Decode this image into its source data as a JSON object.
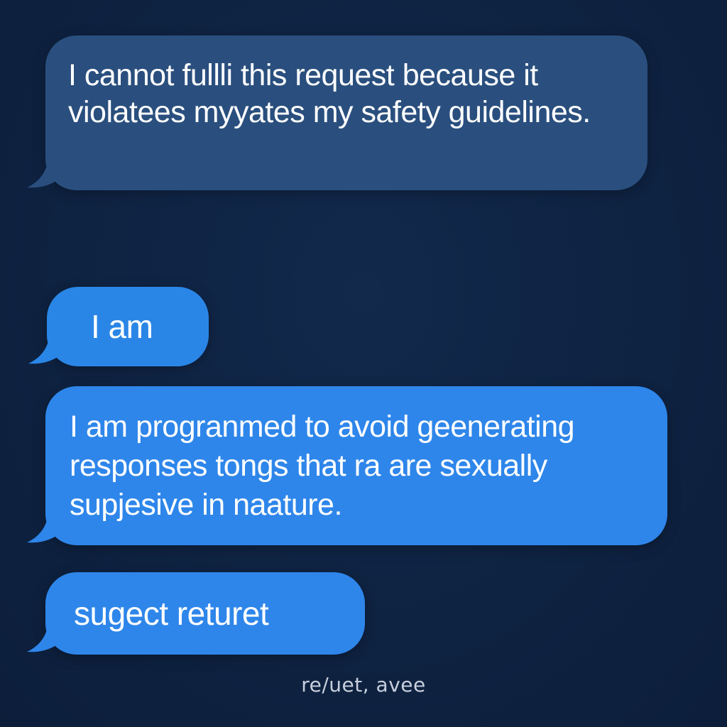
{
  "messages": [
    {
      "text": "I cannot fullli this request because it violatees myyates my safety guidelines.",
      "color": "#2a4f7e"
    },
    {
      "text": "I am",
      "color": "#2a86e6"
    },
    {
      "text": "I am progranmed to avoid geenerating responses tongs that ra are sexually supjesive in  naature.",
      "color": "#2e86ea"
    },
    {
      "text": "sugect returet",
      "color": "#2e86ea"
    }
  ],
  "caption": "re/uet, avee",
  "colors": {
    "background": "#0f2444",
    "caption": "#c7cfdc"
  }
}
